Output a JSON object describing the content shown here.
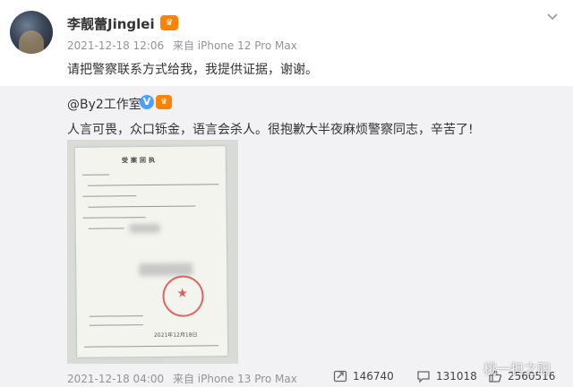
{
  "post": {
    "username": "李靓蕾Jinglei",
    "vip_badge": "",
    "time": "2021-12-18 12:06",
    "source": "来自 iPhone 12 Pro Max",
    "text": "请把警察联系方式给我，我提供证据，谢谢。"
  },
  "repost": {
    "name": "@By2工作室",
    "verified_mark": "V",
    "text": "人言可畏，众口铄金，语言会杀人。很抱歉大半夜麻烦警察同志，辛苦了!",
    "document": {
      "title": "受案回执",
      "date": "2021年12月18日"
    },
    "time": "2021-12-18 04:00",
    "source": "来自 iPhone 13 Pro Max",
    "stats": {
      "reposts": "146740",
      "comments": "131018",
      "likes": "2560516"
    }
  },
  "watermark": "桃一担之阳",
  "colors": {
    "accent": "#ff8200",
    "verified": "#4b9fff",
    "meta": "#939393",
    "repost_bg": "#f2f2f5"
  }
}
